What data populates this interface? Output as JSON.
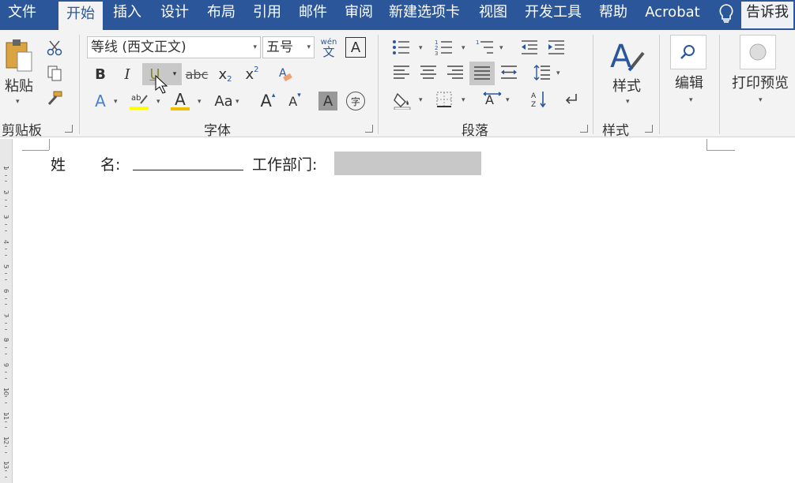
{
  "menu": {
    "tabs": [
      "文件",
      "开始",
      "插入",
      "设计",
      "布局",
      "引用",
      "邮件",
      "审阅",
      "新建选项卡",
      "视图",
      "开发工具",
      "帮助",
      "Acrobat"
    ],
    "tell_me": "告诉我"
  },
  "clipboard": {
    "paste": "粘贴",
    "group": "剪贴板"
  },
  "font": {
    "name": "等线 (西文正文)",
    "size": "五号",
    "group": "字体",
    "phonetic_top": "wén",
    "phonetic_bottom": "文",
    "bold": "B",
    "italic": "I",
    "underline": "U",
    "strike": "abc",
    "sub": "x",
    "sup": "x",
    "case": "Aa",
    "grow": "A",
    "shrink": "A",
    "char_border": "A",
    "char_shade": "A",
    "enclose": "字"
  },
  "paragraph": {
    "group": "段落"
  },
  "styles": {
    "label": "样式",
    "group": "样式"
  },
  "editing": {
    "label": "编辑"
  },
  "print": {
    "label": "打印预览"
  },
  "ruler_numbers": [
    "1",
    "2",
    "3",
    "4",
    "5",
    "6",
    "7",
    "8",
    "9",
    "10",
    "11",
    "12",
    "13"
  ],
  "document": {
    "name_label_1": "姓",
    "name_label_2": "名:",
    "dept_label": "工作部门:"
  },
  "colors": {
    "accent": "#2b579a",
    "highlight": "#ffff00",
    "fontcolor": "#f0c000",
    "hover": "#c8c8c8"
  }
}
